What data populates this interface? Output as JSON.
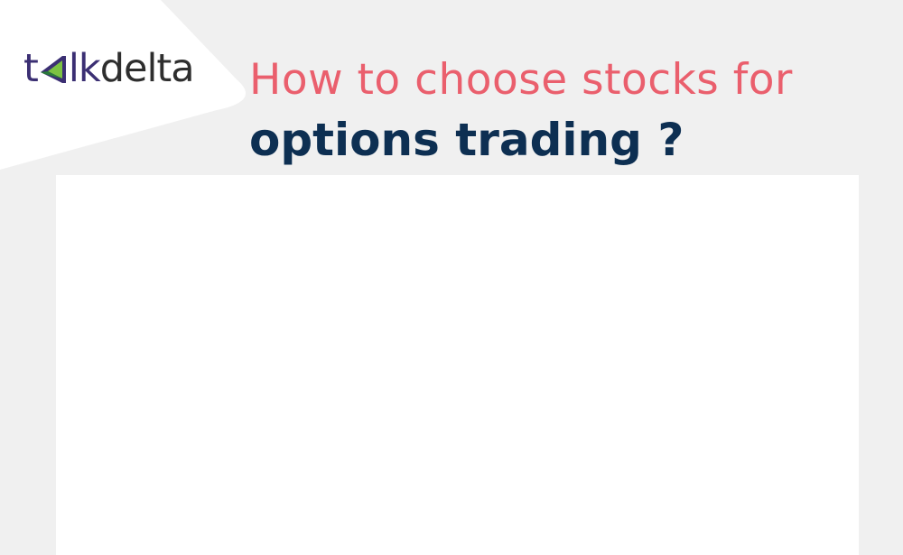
{
  "brand": {
    "logo_text": "talkdelta",
    "colors": {
      "primary": "#3b2f73",
      "accent_green": "#7cc242",
      "dark": "#2e2e2e"
    }
  },
  "heading": {
    "line1": "How to choose stocks for",
    "line2": "options trading ?",
    "line1_color": "#ea5f6d",
    "line2_color": "#0d2f52"
  },
  "background_color": "#f0f0f0",
  "panel_color": "#ffffff"
}
